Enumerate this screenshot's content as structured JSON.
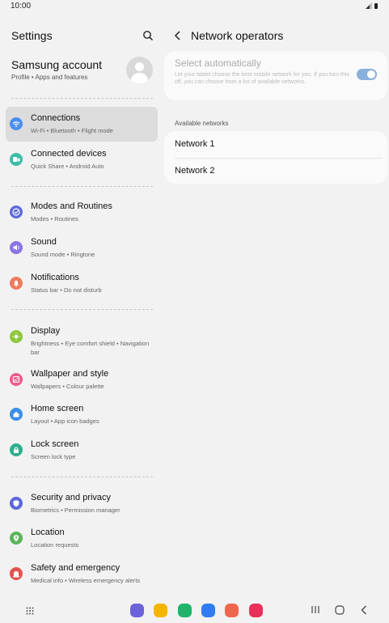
{
  "status_bar": {
    "time": "10:00"
  },
  "settings": {
    "title": "Settings",
    "account": {
      "name": "Samsung account",
      "subtitle": "Profile  •  Apps and features"
    },
    "items": [
      {
        "label": "Connections",
        "sub": "Wi-Fi  •  Bluetooth  •  Flight mode",
        "color": "#4b8df2",
        "icon": "wifi-icon",
        "active": true
      },
      {
        "label": "Connected devices",
        "sub": "Quick Share  •  Android Auto",
        "color": "#3dbda8",
        "icon": "devices-icon"
      },
      {
        "label": "Modes and Routines",
        "sub": "Modes  •  Routines",
        "color": "#5d6ad9",
        "icon": "check-circle-icon"
      },
      {
        "label": "Sound",
        "sub": "Sound mode  •  Ringtone",
        "color": "#8a74e2",
        "icon": "volume-icon"
      },
      {
        "label": "Notifications",
        "sub": "Status bar  •  Do not disturb",
        "color": "#ee7b5f",
        "icon": "bell-icon"
      },
      {
        "label": "Display",
        "sub": "Brightness  •  Eye comfort shield  •  Navigation bar",
        "color": "#8cc83a",
        "icon": "sun-icon"
      },
      {
        "label": "Wallpaper and style",
        "sub": "Wallpapers  •  Colour palette",
        "color": "#ec5d8a",
        "icon": "image-icon"
      },
      {
        "label": "Home screen",
        "sub": "Layout  •  App icon badges",
        "color": "#3b8de8",
        "icon": "home-icon"
      },
      {
        "label": "Lock screen",
        "sub": "Screen lock type",
        "color": "#2fae8e",
        "icon": "lock-icon"
      },
      {
        "label": "Security and privacy",
        "sub": "Biometrics  •  Permission manager",
        "color": "#5a66dc",
        "icon": "shield-icon"
      },
      {
        "label": "Location",
        "sub": "Location requests",
        "color": "#5bb45a",
        "icon": "location-pin-icon"
      },
      {
        "label": "Safety and emergency",
        "sub": "Medical info  •  Wireless emergency alerts",
        "color": "#e4534f",
        "icon": "emergency-icon"
      }
    ]
  },
  "network": {
    "title": "Network operators",
    "select_auto": {
      "label": "Select automatically",
      "description": "Let your tablet choose the best mobile network for you. If you turn this off, you can choose from a list of available networks.",
      "enabled": true
    },
    "section_label": "Available networks",
    "networks": [
      "Network 1",
      "Network 2"
    ]
  },
  "dock_colors": [
    "#6c63d9",
    "#f5b400",
    "#1fb46a",
    "#2f7df0",
    "#f0664d",
    "#e9305a"
  ],
  "accent": "#8ab0dc"
}
